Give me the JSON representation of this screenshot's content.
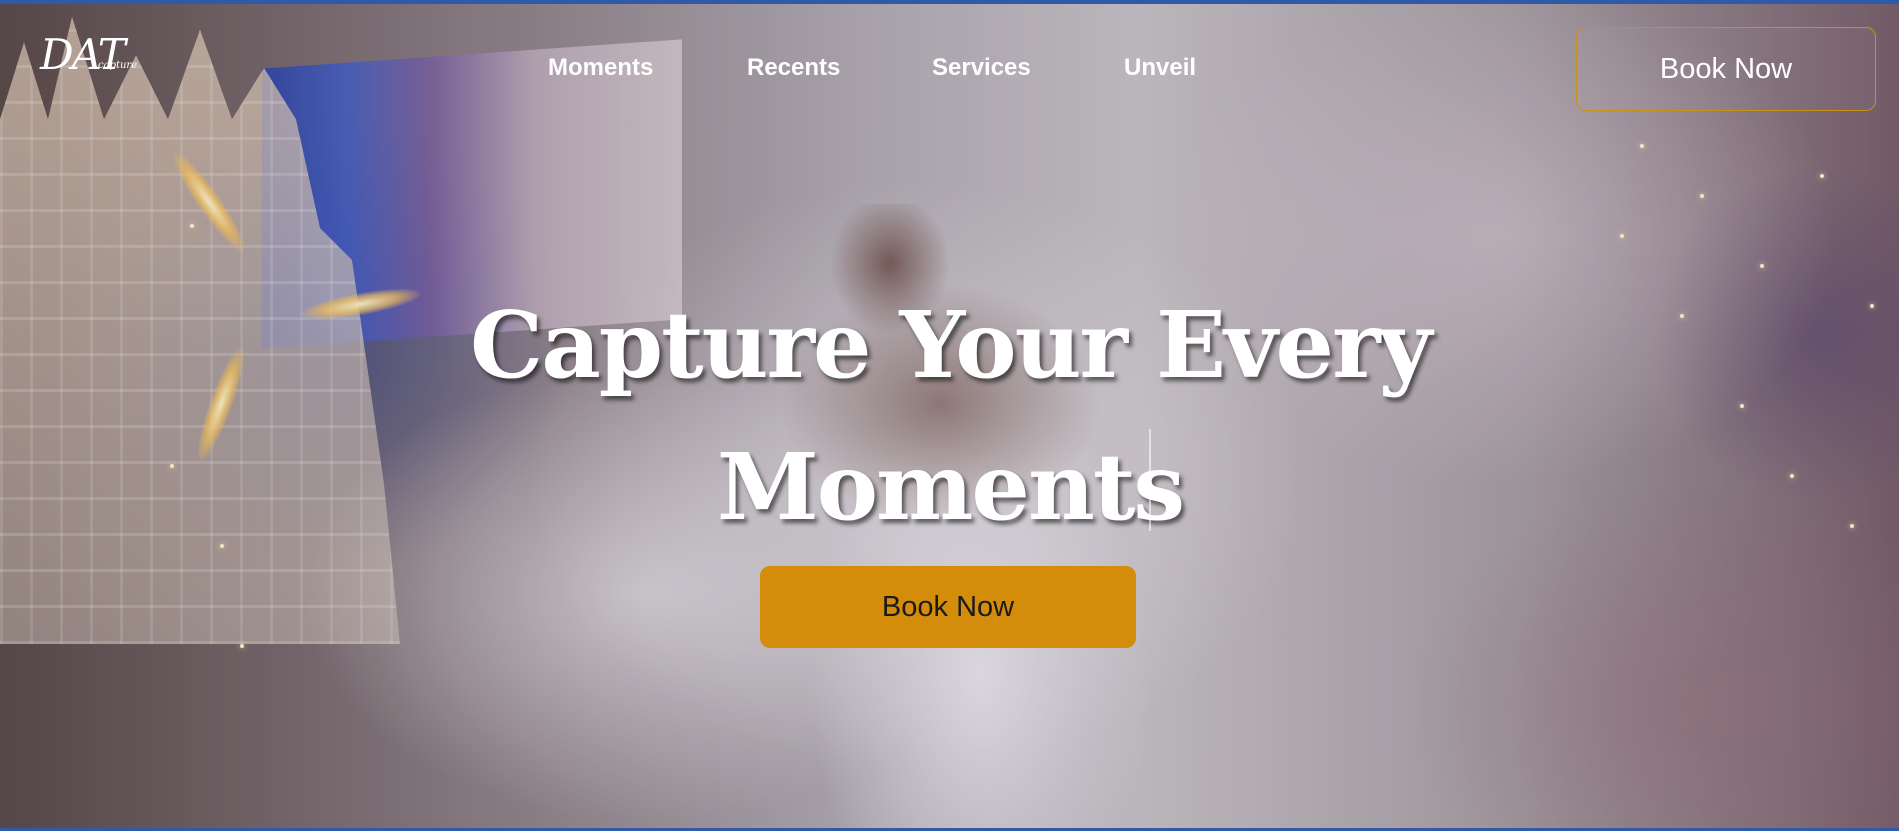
{
  "brand": {
    "logo_main": "DAT",
    "logo_sub": "capture"
  },
  "nav": {
    "items": [
      {
        "label": "Moments"
      },
      {
        "label": "Recents"
      },
      {
        "label": "Services"
      },
      {
        "label": "Unveil"
      }
    ],
    "cta_label": "Book Now"
  },
  "hero": {
    "headline_line1": "Capture Your Every",
    "headline_line2": "Moments",
    "cta_label": "Book Now"
  },
  "colors": {
    "accent": "#d48c0b",
    "cta_border": "#c9911a",
    "window_border": "#2f5aa8"
  }
}
